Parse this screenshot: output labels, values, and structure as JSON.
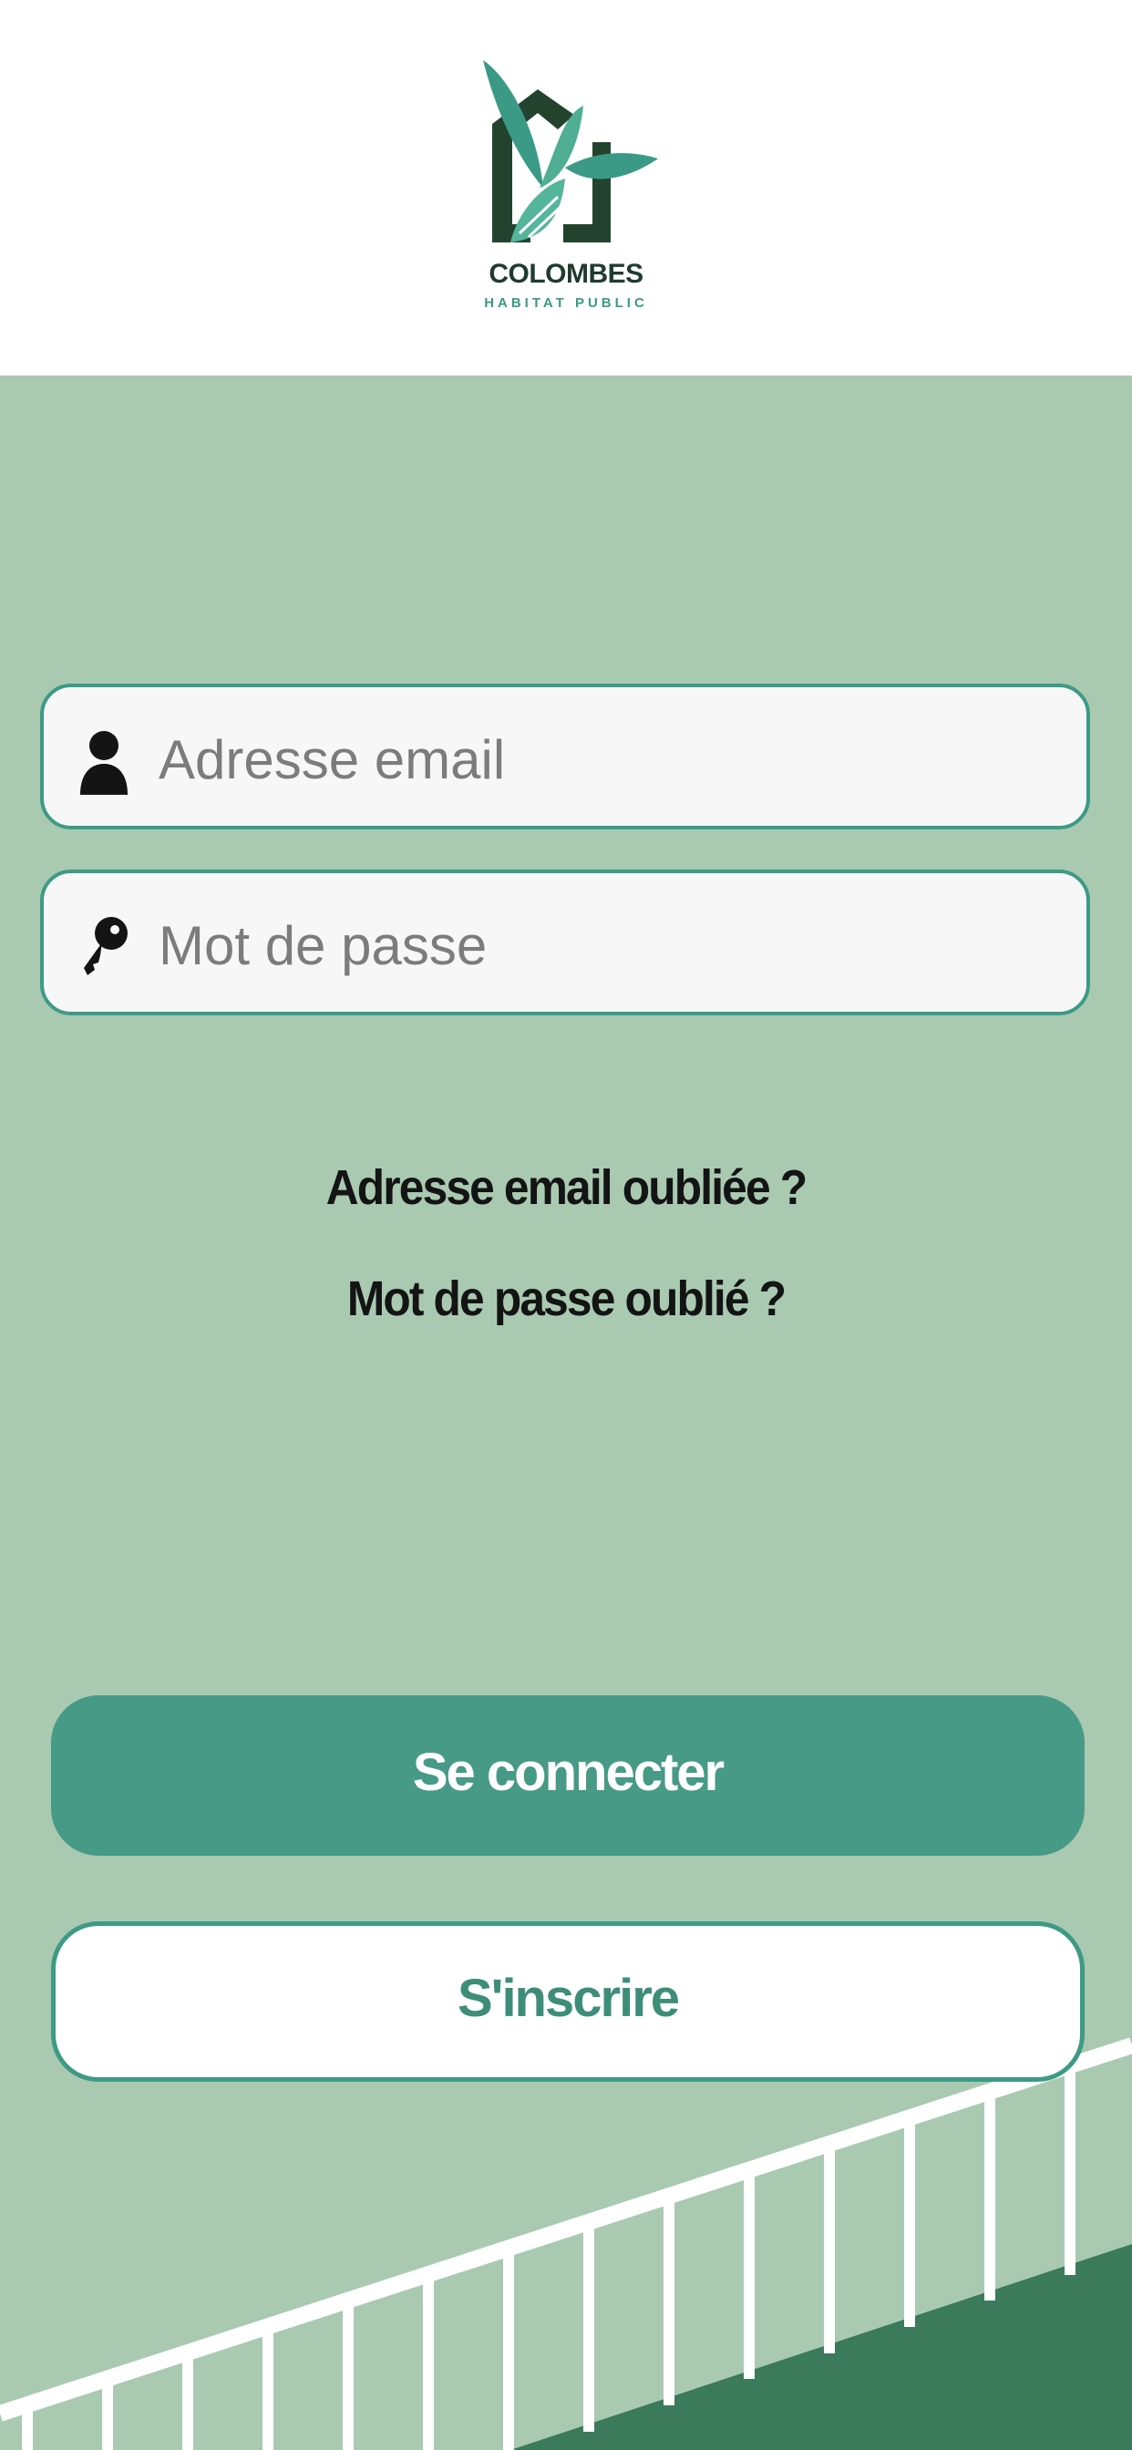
{
  "brand": {
    "name": "COLOMBES",
    "subtitle": "HABITAT PUBLIC",
    "colors": {
      "dark": "#1f3b2d",
      "accent": "#3a9a85",
      "background": "#a9cab1"
    }
  },
  "login": {
    "email_placeholder": "Adresse email",
    "password_placeholder": "Mot de passe",
    "email_icon": "user-icon",
    "password_icon": "key-icon"
  },
  "links": {
    "forgot_email": "Adresse email oubliée ?",
    "forgot_password": "Mot de passe oublié ?"
  },
  "actions": {
    "login_label": "Se connecter",
    "signup_label": "S'inscrire"
  }
}
